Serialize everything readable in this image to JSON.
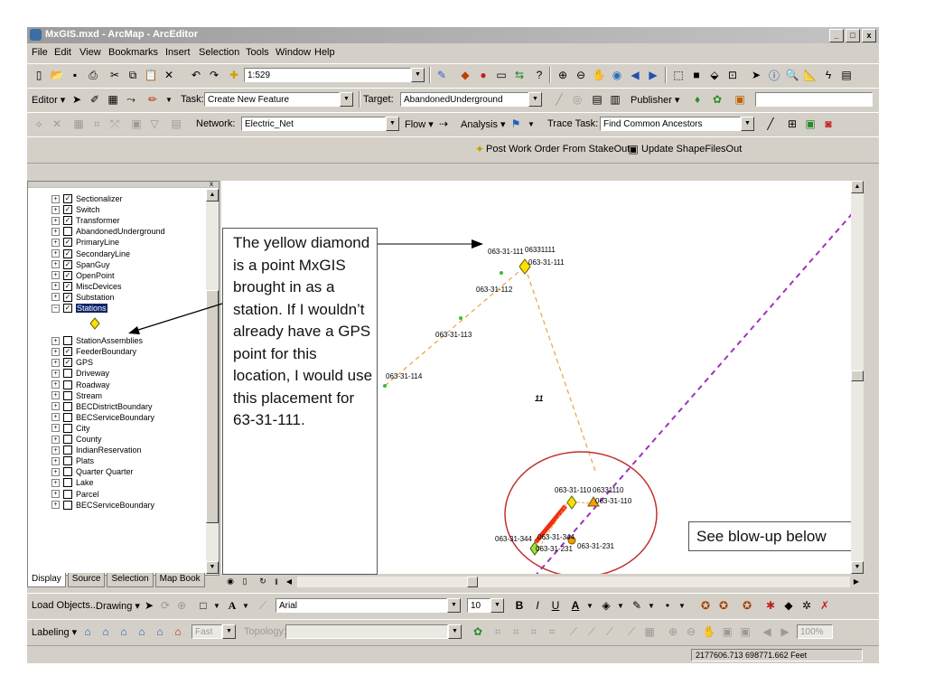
{
  "window": {
    "title": "MxGIS.mxd - ArcMap - ArcEditor",
    "minimize": "_",
    "maximize": "□",
    "close": "x"
  },
  "menu": [
    "File",
    "Edit",
    "View",
    "Bookmarks",
    "Insert",
    "Selection",
    "Tools",
    "Window",
    "Help"
  ],
  "standard_toolbar": {
    "scale": "1:529"
  },
  "editor_toolbar": {
    "editor_label": "Editor ▾",
    "task_label": "Task:",
    "task_value": "Create New Feature",
    "target_label": "Target:",
    "target_value": "AbandonedUnderground",
    "publisher_label": "Publisher ▾"
  },
  "network_toolbar": {
    "network_label": "Network:",
    "network_value": "Electric_Net",
    "flow_label": "Flow ▾",
    "analysis_label": "Analysis ▾",
    "trace_task_label": "Trace Task:",
    "trace_task_value": "Find Common Ancestors"
  },
  "custom_toolbar": {
    "post_work_order": "Post Work Order From StakeOut",
    "update_shapefiles": "Update ShapeFilesOut"
  },
  "toc": {
    "layers": [
      {
        "name": "Sectionalizer",
        "checked": true
      },
      {
        "name": "Switch",
        "checked": true
      },
      {
        "name": "Transformer",
        "checked": true
      },
      {
        "name": "AbandonedUnderground",
        "checked": false
      },
      {
        "name": "PrimaryLine",
        "checked": true
      },
      {
        "name": "SecondaryLine",
        "checked": true
      },
      {
        "name": "SpanGuy",
        "checked": true
      },
      {
        "name": "OpenPoint",
        "checked": true
      },
      {
        "name": "MiscDevices",
        "checked": true
      },
      {
        "name": "Substation",
        "checked": true
      },
      {
        "name": "Stations",
        "checked": true,
        "selected": true,
        "expanded": true
      },
      {
        "name": "StationAssemblies",
        "checked": false
      },
      {
        "name": "FeederBoundary",
        "checked": true
      },
      {
        "name": "GPS",
        "checked": true
      },
      {
        "name": "Driveway",
        "checked": false
      },
      {
        "name": "Roadway",
        "checked": false
      },
      {
        "name": "Stream",
        "checked": false
      },
      {
        "name": "BECDistrictBoundary",
        "checked": false
      },
      {
        "name": "BECServiceBoundary",
        "checked": false
      },
      {
        "name": "City",
        "checked": false
      },
      {
        "name": "County",
        "checked": false
      },
      {
        "name": "IndianReservation",
        "checked": false
      },
      {
        "name": "Plats",
        "checked": false
      },
      {
        "name": "Quarter Quarter",
        "checked": false
      },
      {
        "name": "Lake",
        "checked": false
      },
      {
        "name": "Parcel",
        "checked": false
      },
      {
        "name": "BECServiceBoundary",
        "checked": false
      }
    ],
    "tabs": [
      "Display",
      "Source",
      "Selection",
      "Map Book"
    ]
  },
  "map": {
    "labels": {
      "l111a": "063-31-111",
      "l111b": "06331111",
      "l111c": "063-31-111",
      "l112": "063-31-112",
      "l113": "063-31-113",
      "l114": "063-31-114",
      "l11": "11",
      "l110a": "063-31-110",
      "l110b": "06331110",
      "l110c": "063-31-110",
      "l344a": "063-31-344",
      "l344b": "063-31-344",
      "l231a": "063-31-231",
      "l231b": "063-31-231"
    },
    "callout_text": "The yellow diamond is a point MxGIS brought in as a station.  If I wouldn’t already have a GPS point for this location, I would use this placement  for 63-31-111.",
    "blowup_text": "See blow-up below"
  },
  "draw_toolbar": {
    "load_objects": "Load Objects...",
    "drawing": "Drawing ▾",
    "font": "Arial",
    "font_size": "10"
  },
  "label_toolbar": {
    "labeling": "Labeling ▾",
    "fast": "Fast",
    "topology": "Topology:",
    "zoom": "100%"
  },
  "status": {
    "coordinates": "2177606.713  698771.662 Feet"
  },
  "colors": {
    "map_line": "#f0a040",
    "boundary": "#a030c0",
    "circle": "#c03030",
    "station": "#ffe000",
    "gps": "#30c030"
  }
}
